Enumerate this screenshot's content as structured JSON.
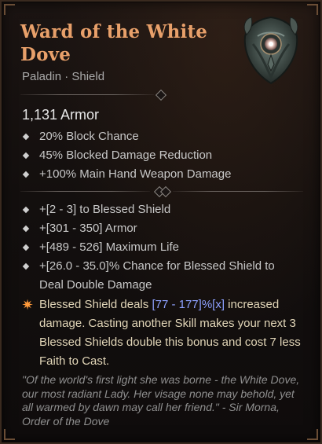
{
  "item": {
    "name_line1": "Ward of the White",
    "name_line2": "Dove",
    "type_line": "Paladin · Shield",
    "icon": "shield-icon",
    "armor": "1,131 Armor"
  },
  "implicits": [
    "20% Block Chance",
    "45% Blocked Damage Reduction",
    "+100% Main Hand Weapon Damage"
  ],
  "affixes": [
    "+[2 - 3] to Blessed Shield",
    "+[301 - 350] Armor",
    "+[489 - 526] Maximum Life",
    "+[26.0 - 35.0]% Chance for Blessed Shield to Deal Double Damage"
  ],
  "legendary": {
    "icon": "legendary-star-icon",
    "prefix": "Blessed Shield deals ",
    "range": "[77 - 177]%[x]",
    "suffix": " increased damage. Casting another Skill makes your next 3 Blessed Shields double this bonus and cost 7 less Faith to Cast."
  },
  "flavor": "\"Of the world's first light she was borne - the White Dove, our most radiant Lady. Her visage none may behold, yet all warmed by dawn may call her friend.\" - Sir Morna, Order of the Dove",
  "colors": {
    "title": "#e8a06a",
    "range": "#8ea1ff",
    "legendary_star": "#ff9a3a"
  }
}
